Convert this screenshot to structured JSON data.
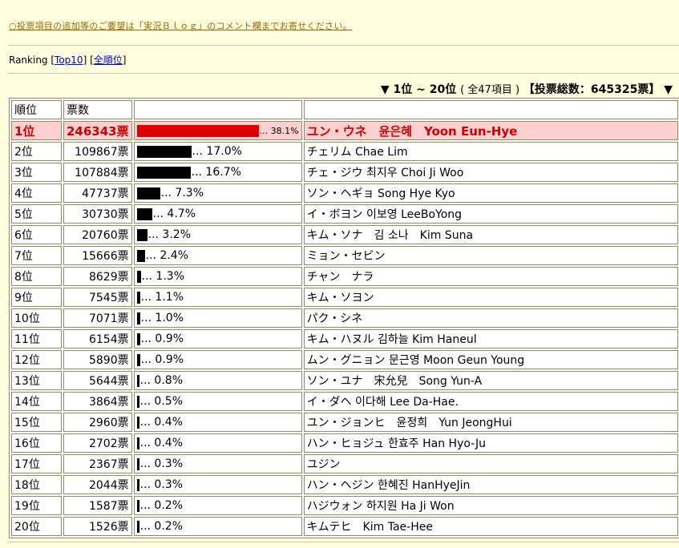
{
  "notice": "○投票項目の追加等のご要望は「実況Ｂｌｏｇ」のコメント欄までお寄せください。",
  "nav": {
    "label": "Ranking",
    "links": [
      "Top10",
      "全順位"
    ]
  },
  "range": {
    "title": "▼ 1位 ~ 20位",
    "count": "( 全47項目 )",
    "total": "【投票総数：645325票】 ▼"
  },
  "table": {
    "headers": [
      "順位",
      "票数",
      "",
      ""
    ],
    "rows": [
      {
        "rank": "1位",
        "votes": "246343票",
        "pct_label": "... 38.1%",
        "pct": 38.1,
        "name": "ユン・ウネ　윤은혜　Yoon Eun-Hye"
      },
      {
        "rank": "2位",
        "votes": "109867票",
        "pct_label": "... 17.0%",
        "pct": 17.0,
        "name": "チェリム Chae Lim"
      },
      {
        "rank": "3位",
        "votes": "107884票",
        "pct_label": "... 16.7%",
        "pct": 16.7,
        "name": "チェ・ジウ 최지우 Choi Ji Woo"
      },
      {
        "rank": "4位",
        "votes": "47737票",
        "pct_label": "... 7.3%",
        "pct": 7.3,
        "name": "ソン・ヘギョ Song Hye Kyo"
      },
      {
        "rank": "5位",
        "votes": "30730票",
        "pct_label": "... 4.7%",
        "pct": 4.7,
        "name": "イ・ボヨン 이보영 LeeBoYong"
      },
      {
        "rank": "6位",
        "votes": "20760票",
        "pct_label": "... 3.2%",
        "pct": 3.2,
        "name": "キム・ソナ　김 소나　Kim Suna"
      },
      {
        "rank": "7位",
        "votes": "15666票",
        "pct_label": "... 2.4%",
        "pct": 2.4,
        "name": "ミョン・セビン"
      },
      {
        "rank": "8位",
        "votes": "8629票",
        "pct_label": "... 1.3%",
        "pct": 1.3,
        "name": "チャン　ナラ"
      },
      {
        "rank": "9位",
        "votes": "7545票",
        "pct_label": "... 1.1%",
        "pct": 1.1,
        "name": "キム・ソヨン"
      },
      {
        "rank": "10位",
        "votes": "7071票",
        "pct_label": "... 1.0%",
        "pct": 1.0,
        "name": "パク・シネ"
      },
      {
        "rank": "11位",
        "votes": "6154票",
        "pct_label": "... 0.9%",
        "pct": 0.9,
        "name": "キム・ハヌル 김하늘 Kim Haneul"
      },
      {
        "rank": "12位",
        "votes": "5890票",
        "pct_label": "... 0.9%",
        "pct": 0.9,
        "name": "ムン・グニョン 문근영 Moon Geun Young"
      },
      {
        "rank": "13位",
        "votes": "5644票",
        "pct_label": "... 0.8%",
        "pct": 0.8,
        "name": "ソン・ユナ　宋允兒　Song Yun-A"
      },
      {
        "rank": "14位",
        "votes": "3864票",
        "pct_label": "... 0.5%",
        "pct": 0.5,
        "name": "イ・ダヘ 이다해 Lee Da-Hae."
      },
      {
        "rank": "15位",
        "votes": "2960票",
        "pct_label": "... 0.4%",
        "pct": 0.4,
        "name": "ユン・ジョンヒ　윤정희　Yun JeongHui"
      },
      {
        "rank": "16位",
        "votes": "2702票",
        "pct_label": "... 0.4%",
        "pct": 0.4,
        "name": "ハン・ヒョジュ 한효주 Han Hyo-Ju"
      },
      {
        "rank": "17位",
        "votes": "2367票",
        "pct_label": "... 0.3%",
        "pct": 0.3,
        "name": "ユジン"
      },
      {
        "rank": "18位",
        "votes": "2044票",
        "pct_label": "... 0.3%",
        "pct": 0.3,
        "name": "ハン・ヘジン 한혜진 HanHyeJin"
      },
      {
        "rank": "19位",
        "votes": "1587票",
        "pct_label": "... 0.2%",
        "pct": 0.2,
        "name": "ハジウォン 하지원 Ha Ji Won"
      },
      {
        "rank": "20位",
        "votes": "1526票",
        "pct_label": "... 0.2%",
        "pct": 0.2,
        "name": "キムテヒ　Kim Tae-Hee"
      }
    ]
  },
  "colors": {
    "background": "#ffffe0",
    "first_row_bg": "#ffd0d0",
    "first_row_text": "#cc0000",
    "bar_first": "#dd0000",
    "bar": "#000000",
    "link": "#0000cc",
    "notice": "#996600"
  }
}
